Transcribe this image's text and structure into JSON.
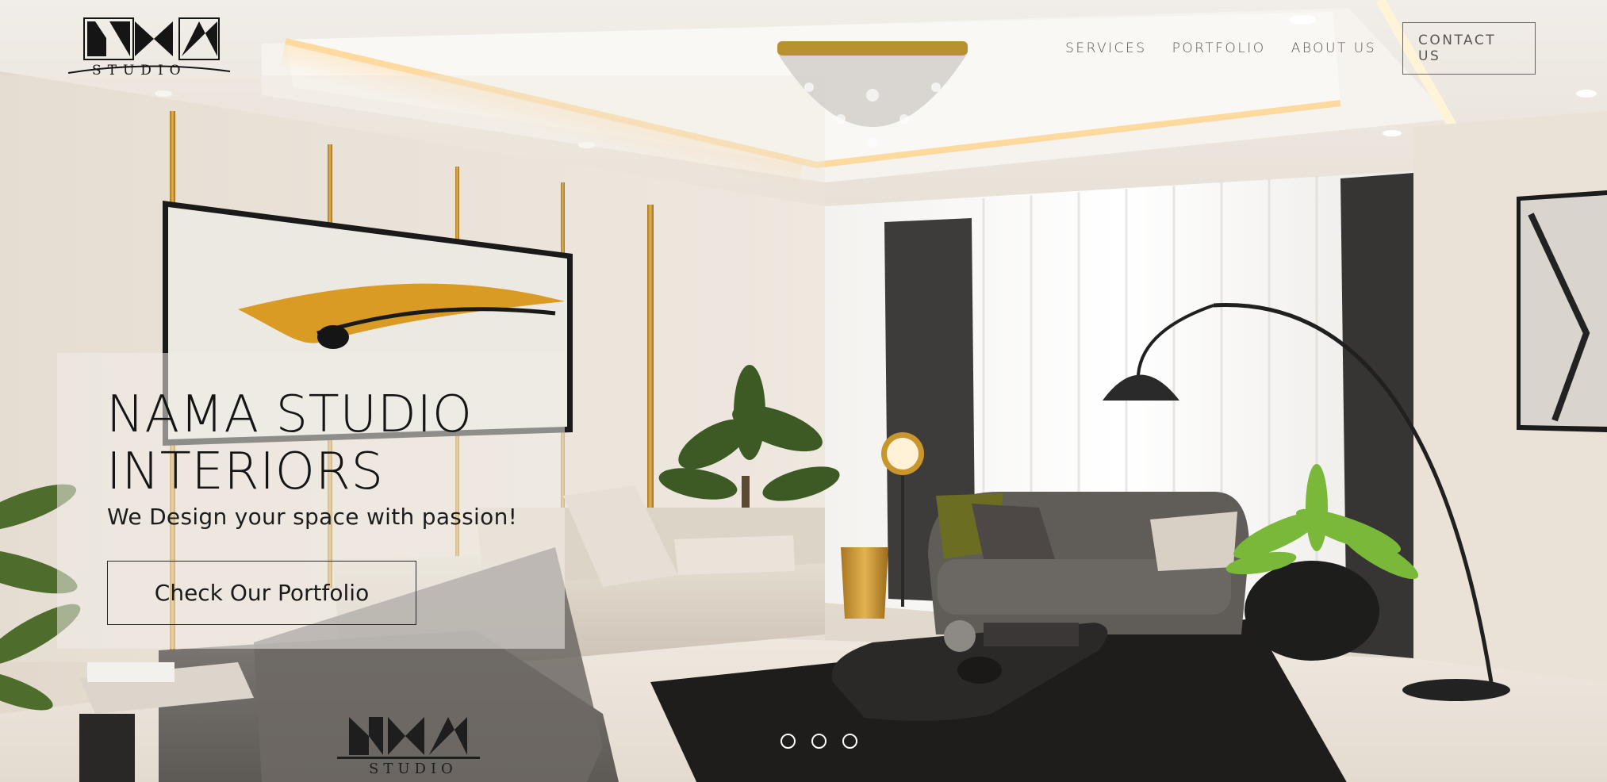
{
  "header": {
    "logo_name": "NAMA STUDIO",
    "nav": [
      {
        "label": "SERVICES"
      },
      {
        "label": "PORTFOLIO"
      },
      {
        "label": "ABOUT US"
      }
    ],
    "contact_label": "CONTACT US"
  },
  "hero": {
    "title_line1": "NAMA STUDIO",
    "title_line2": "INTERIORS",
    "subtitle": "We Design your space with passion!",
    "cta_label": "Check Our Portfolio",
    "background_icon": "living-room-photo",
    "watermark_name": "NAMA STUDIO"
  },
  "carousel": {
    "slide_count": 3
  },
  "colors": {
    "accent_gold": "#c9962e",
    "nav_text": "#5a5550",
    "title_text": "#151515"
  }
}
